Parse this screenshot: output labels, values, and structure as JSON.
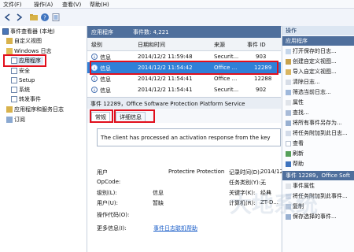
{
  "menu": {
    "items": [
      "文件(F)",
      "操作(A)",
      "查看(V)",
      "帮助(H)"
    ]
  },
  "left_panel": {
    "root": "事件查看器 (本地)",
    "custom_views": "自定义视图",
    "windows_logs": "Windows 日志",
    "windows_log_items": [
      "应用程序",
      "安全",
      "Setup",
      "系统",
      "转发事件"
    ],
    "apps_services": "应用程序和服务日志",
    "subscriptions": "订阅"
  },
  "event_list": {
    "title": "应用程序",
    "count_label": "事件数: 4,221",
    "columns": [
      "级别",
      "日期和时间",
      "来源",
      "事件 ID"
    ],
    "rows": [
      {
        "level": "信息",
        "date": "2014/12/2 11:59:48",
        "source": "Securit...",
        "id": "903"
      },
      {
        "level": "信息",
        "date": "2014/12/2 11:54:42",
        "source": "Office ...",
        "id": "12289"
      },
      {
        "level": "信息",
        "date": "2014/12/2 11:54:41",
        "source": "Office ...",
        "id": "12288"
      },
      {
        "level": "信息",
        "date": "2014/12/2 11:54:41",
        "source": "Securit...",
        "id": "902"
      }
    ]
  },
  "detail": {
    "header": "事件 12289，Office Software Protection Platform Service",
    "tabs": [
      "常规",
      "详细信息"
    ],
    "description": "The client has processed an activation response from the key",
    "fields": {
      "user_label": "用户",
      "user_value": "Protectire Protection",
      "opcode_label": "OpCode:",
      "level_label": "级别(L):",
      "level_value": "信息",
      "user2_label": "用户(U):",
      "user2_value": "暂缺",
      "opcode2_label": "操作代码(O):",
      "more_label": "更多信息(I):",
      "more_link": "事件日志联机帮助",
      "logged_label": "记录时间(D):",
      "task_label": "任务类别(Y):",
      "keyword_label": "关键字(K):",
      "computer_label": "计算机(R):",
      "logged_value": "2014/12",
      "task_value": "无",
      "keyword_value": "经典",
      "computer_value": "ZT-D..."
    }
  },
  "actions": {
    "title": "操作",
    "section1": "应用程序",
    "items": [
      "打开保存的日志...",
      "创建自定义视图...",
      "导入自定义视图...",
      "清除日志...",
      "筛选当前日志...",
      "属性",
      "查找...",
      "将所有事件另存为...",
      "将任务附加到此日志...",
      "查看",
      "刷新",
      "帮助"
    ],
    "section2": "事件 12289，Office Soft",
    "items2": [
      "事件属性",
      "将任务附加到此事件...",
      "复制",
      "保存选择的事件..."
    ]
  },
  "watermark": "大地系统",
  "colors": {
    "accent": "#2f80d8",
    "annotation": "#e10f1c",
    "header_blue": "#4f6f9c"
  }
}
